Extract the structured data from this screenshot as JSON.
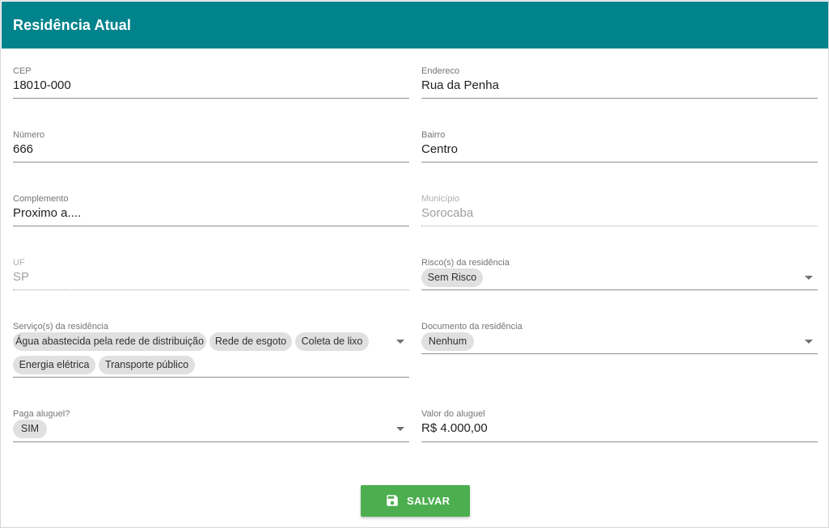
{
  "header": {
    "title": "Residência Atual"
  },
  "fields": {
    "cep": {
      "label": "CEP",
      "value": "18010-000"
    },
    "endereco": {
      "label": "Endereco",
      "value": "Rua da Penha"
    },
    "numero": {
      "label": "Número",
      "value": "666"
    },
    "bairro": {
      "label": "Bairro",
      "value": "Centro"
    },
    "complemento": {
      "label": "Complemento",
      "value": "Proximo a...."
    },
    "municipio": {
      "label": "Município",
      "value": "Sorocaba"
    },
    "uf": {
      "label": "UF",
      "value": "SP"
    },
    "riscos": {
      "label": "Risco(s) da residência",
      "chips": [
        "Sem Risco"
      ]
    },
    "servicos": {
      "label": "Serviço(s) da residência",
      "chips": [
        "Água abastecida pela rede de distribuição",
        "Rede de esgoto",
        "Coleta de lixo",
        "Energia elétrica",
        "Transporte público"
      ]
    },
    "documento": {
      "label": "Documento da residência",
      "chips": [
        "Nenhum"
      ]
    },
    "paga_aluguel": {
      "label": "Paga aluguel?",
      "chips": [
        "SIM"
      ]
    },
    "valor_aluguel": {
      "label": "Valor do aluguel",
      "value": "R$ 4.000,00"
    }
  },
  "actions": {
    "save_label": "SALVAR",
    "save_icon": "floppy-disk-icon"
  },
  "colors": {
    "header": "#01838c",
    "save": "#4cae4f",
    "chip": "#e0e0e0"
  }
}
